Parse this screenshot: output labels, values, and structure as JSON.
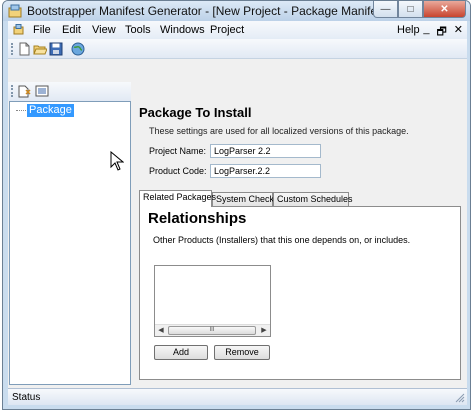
{
  "window": {
    "title": "Bootstrapper Manifest Generator - [New Project - Package Manifest]",
    "controls": {
      "minimize": "—",
      "maximize": "□",
      "close": "✕"
    }
  },
  "menu": {
    "items": [
      "File",
      "Edit",
      "View",
      "Tools",
      "Windows",
      "Project",
      "Help"
    ],
    "mdi_controls": [
      "_",
      "🗗",
      "✕"
    ]
  },
  "toolbar": {
    "icons": [
      "new-file-icon",
      "open-folder-icon",
      "save-icon",
      "globe-icon"
    ]
  },
  "toolbar2": {
    "icons": [
      "add-file-icon",
      "edit-list-icon"
    ]
  },
  "tree": {
    "items": [
      {
        "label": "Package",
        "selected": true
      }
    ]
  },
  "panel": {
    "heading": "Package To Install",
    "description": "These settings are used for all localized versions of this package.",
    "project_name_label": "Project Name:",
    "project_name_value": "LogParser 2.2",
    "product_code_label": "Product Code:",
    "product_code_value": "LogParser.2.2"
  },
  "tabs": {
    "items": [
      "Related Packages",
      "System Checks",
      "Custom Schedules"
    ],
    "active": "Related Packages"
  },
  "relationships": {
    "title": "Relationships",
    "description": "Other Products (Installers) that this one depends on, or includes.",
    "scroll_thumb": "III",
    "add_label": "Add",
    "remove_label": "Remove"
  },
  "status": {
    "text": "Status"
  },
  "colors": {
    "selection": "#3399ff",
    "titlebar": "#c9dcee",
    "close": "#c8442e"
  }
}
